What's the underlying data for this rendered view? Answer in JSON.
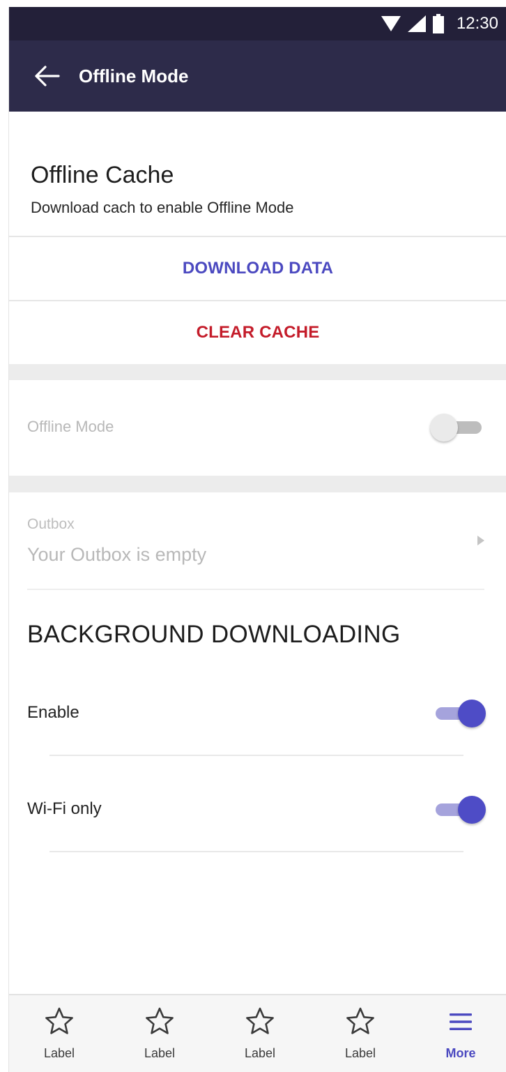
{
  "status_bar": {
    "time": "12:30",
    "icons": [
      "wifi-icon",
      "signal-icon",
      "battery-icon"
    ]
  },
  "app_bar": {
    "title": "Offline Mode",
    "back_icon": "arrow-left-icon"
  },
  "offline_cache": {
    "title": "Offline Cache",
    "subtitle": "Download cach to enable Offline Mode",
    "download_label": "DOWNLOAD DATA",
    "clear_label": "CLEAR CACHE"
  },
  "offline_mode": {
    "label": "Offline Mode",
    "enabled": false
  },
  "outbox": {
    "label": "Outbox",
    "value": "Your Outbox is empty",
    "chevron_icon": "chevron-right-icon"
  },
  "background_downloading": {
    "heading": "BACKGROUND DOWNLOADING",
    "settings": [
      {
        "label": "Enable",
        "enabled": true
      },
      {
        "label": "Wi-Fi only",
        "enabled": true
      }
    ]
  },
  "bottom_nav": {
    "items": [
      {
        "label": "Label",
        "icon": "star-icon"
      },
      {
        "label": "Label",
        "icon": "star-icon"
      },
      {
        "label": "Label",
        "icon": "star-icon"
      },
      {
        "label": "Label",
        "icon": "star-icon"
      },
      {
        "label": "More",
        "icon": "menu-icon",
        "active": true
      }
    ]
  },
  "colors": {
    "app_bar": "#2d2b4a",
    "status_bar": "#232039",
    "primary_action": "#4b49c0",
    "destructive_action": "#c41c2a",
    "toggle_on": "#4e4cc6"
  }
}
